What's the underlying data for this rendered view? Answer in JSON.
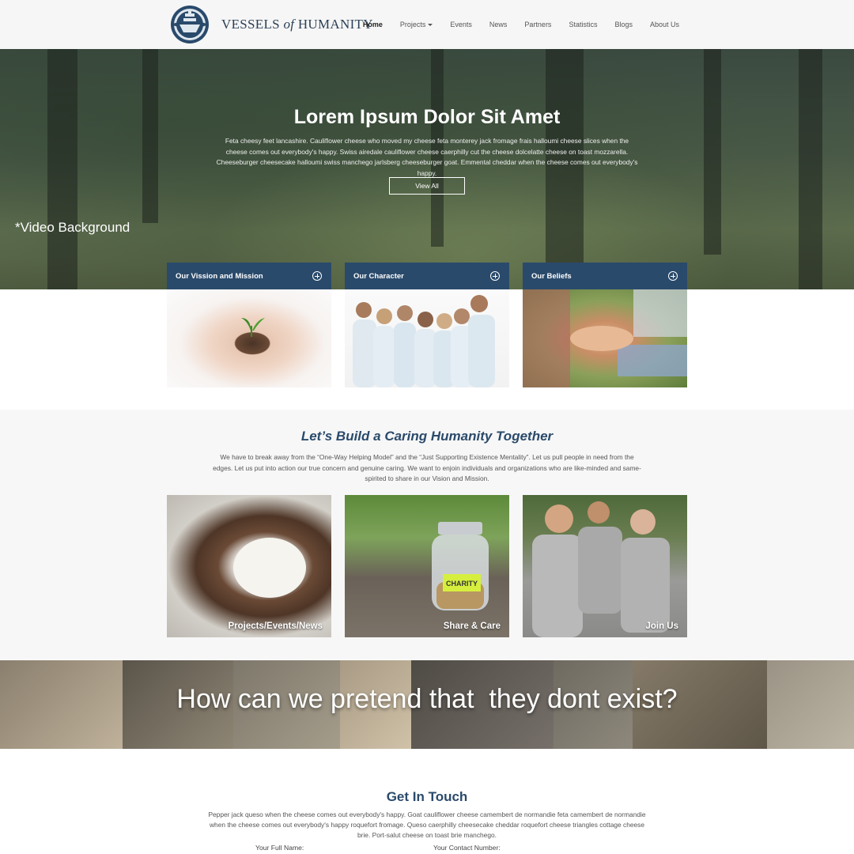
{
  "brand": {
    "name_part1": "VESSELS",
    "name_part2": "of",
    "name_part3": "HUMANITY"
  },
  "nav": {
    "items": [
      {
        "label": "Home",
        "active": true
      },
      {
        "label": "Projects",
        "dropdown": true
      },
      {
        "label": "Events"
      },
      {
        "label": "News"
      },
      {
        "label": "Partners"
      },
      {
        "label": "Statistics"
      },
      {
        "label": "Blogs"
      },
      {
        "label": "About Us"
      }
    ]
  },
  "hero": {
    "title": "Lorem Ipsum Dolor Sit Amet",
    "text": "Feta cheesy feet lancashire. Cauliflower cheese who moved my cheese feta monterey jack fromage frais halloumi cheese slices when the cheese comes out everybody's happy. Swiss airedale cauliflower cheese caerphilly cut the cheese dolcelatte cheese on toast mozzarella. Cheeseburger cheesecake halloumi swiss manchego jarlsberg cheeseburger goat. Emmental cheddar when the cheese comes out everybody's happy.",
    "button": "View All",
    "note": "*Video Background"
  },
  "cards": [
    {
      "title": "Our Vission and Mission",
      "icon": "plus-circle-icon"
    },
    {
      "title": "Our Character",
      "icon": "plus-circle-icon"
    },
    {
      "title": "Our Beliefs",
      "icon": "plus-circle-icon"
    }
  ],
  "caring": {
    "title": "Let’s Build a Caring Humanity Together",
    "text": "We have to break away from the “One-Way Helping Model” and the “Just Supporting Existence Mentality”. Let us pull people in need from the edges. Let us put into action our true concern and genuine caring. We want to enjoin individuals and organizations who are like-minded and same-spirited to share in our Vision and Mission.",
    "tiles": [
      {
        "label": "Projects/Events/News"
      },
      {
        "label": "Share & Care",
        "jar_label": "CHARITY"
      },
      {
        "label": "Join Us"
      }
    ]
  },
  "banner": {
    "text": "How can we pretend that  they dont exist?"
  },
  "contact": {
    "title": "Get In Touch",
    "text": "Pepper jack queso when the cheese comes out everybody's happy. Goat cauliflower cheese camembert de normandie feta camembert de normandie when the cheese comes out everybody's happy roquefort fromage. Queso caerphilly cheesecake cheddar roquefort cheese triangles cottage cheese brie. Port-salut cheese on toast brie manchego.",
    "fields": [
      {
        "label": "Your Full Name:"
      },
      {
        "label": "Your Contact Number:"
      }
    ]
  },
  "colors": {
    "brand_navy": "#2a4a6b",
    "header_bg": "#f6f6f6",
    "section_bg": "#f7f7f7"
  }
}
